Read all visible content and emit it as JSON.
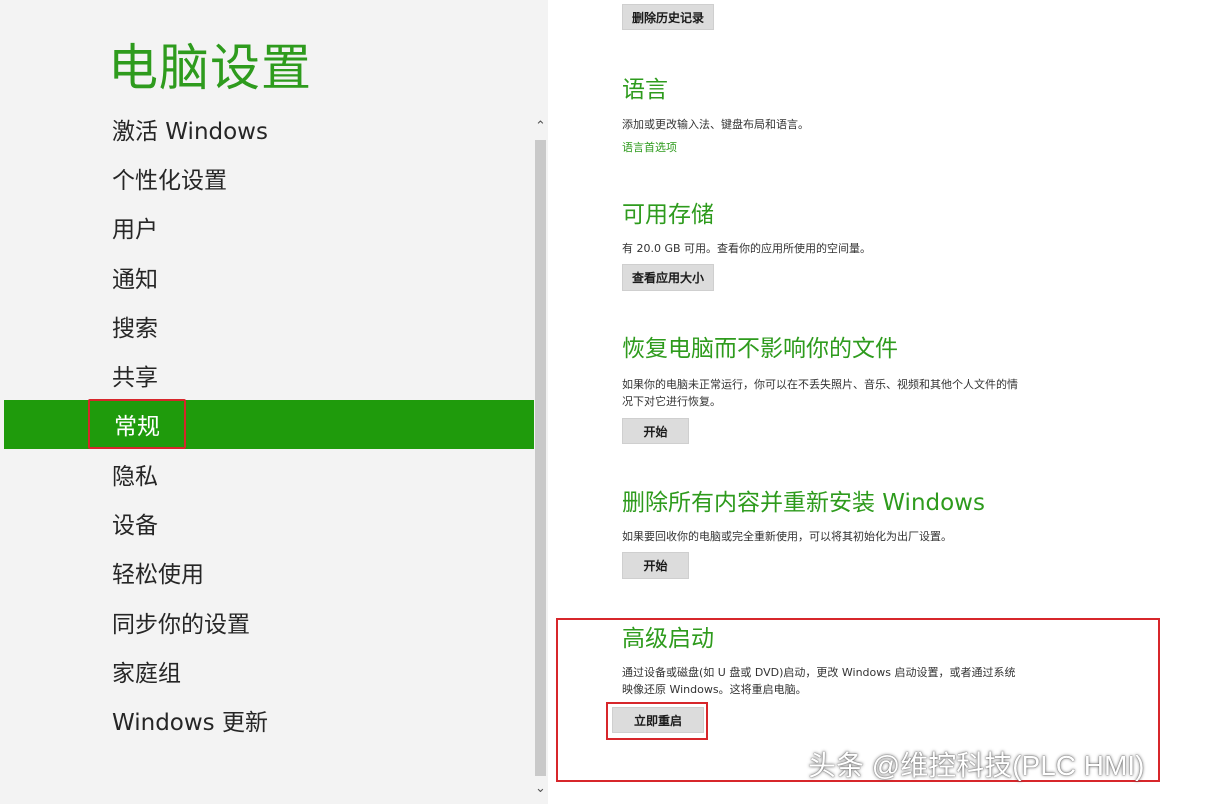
{
  "left": {
    "title": "电脑设置",
    "nav": [
      {
        "label": "激活 Windows"
      },
      {
        "label": "个性化设置"
      },
      {
        "label": "用户"
      },
      {
        "label": "通知"
      },
      {
        "label": "搜索"
      },
      {
        "label": "共享"
      },
      {
        "label": "常规",
        "selected": true
      },
      {
        "label": "隐私"
      },
      {
        "label": "设备"
      },
      {
        "label": "轻松使用"
      },
      {
        "label": "同步你的设置"
      },
      {
        "label": "家庭组"
      },
      {
        "label": "Windows 更新"
      }
    ]
  },
  "right": {
    "delete_history_button": "删除历史记录",
    "language": {
      "title": "语言",
      "desc": "添加或更改输入法、键盘布局和语言。",
      "link": "语言首选项"
    },
    "storage": {
      "title": "可用存储",
      "desc": "有 20.0 GB 可用。查看你的应用所使用的空间量。",
      "button": "查看应用大小"
    },
    "refresh": {
      "title": "恢复电脑而不影响你的文件",
      "desc_lines": [
        "如果你的电脑未正常运行，你可以在不丢失照片、音乐、视频和其他个人文件的情",
        "况下对它进行恢复。"
      ],
      "button": "开始"
    },
    "reset": {
      "title": "删除所有内容并重新安装 Windows",
      "desc": "如果要回收你的电脑或完全重新使用，可以将其初始化为出厂设置。",
      "button": "开始"
    },
    "advanced": {
      "title": "高级启动",
      "desc_lines": [
        "通过设备或磁盘(如 U 盘或 DVD)启动，更改 Windows 启动设置，或者通过系统",
        "映像还原 Windows。这将重启电脑。"
      ],
      "button": "立即重启"
    }
  },
  "watermark": "头条 @维控科技(PLC HMI)",
  "colors": {
    "accent_green": "#2e9b1d",
    "selected_bg": "#1f9b0c",
    "highlight_red": "#d7262b"
  }
}
